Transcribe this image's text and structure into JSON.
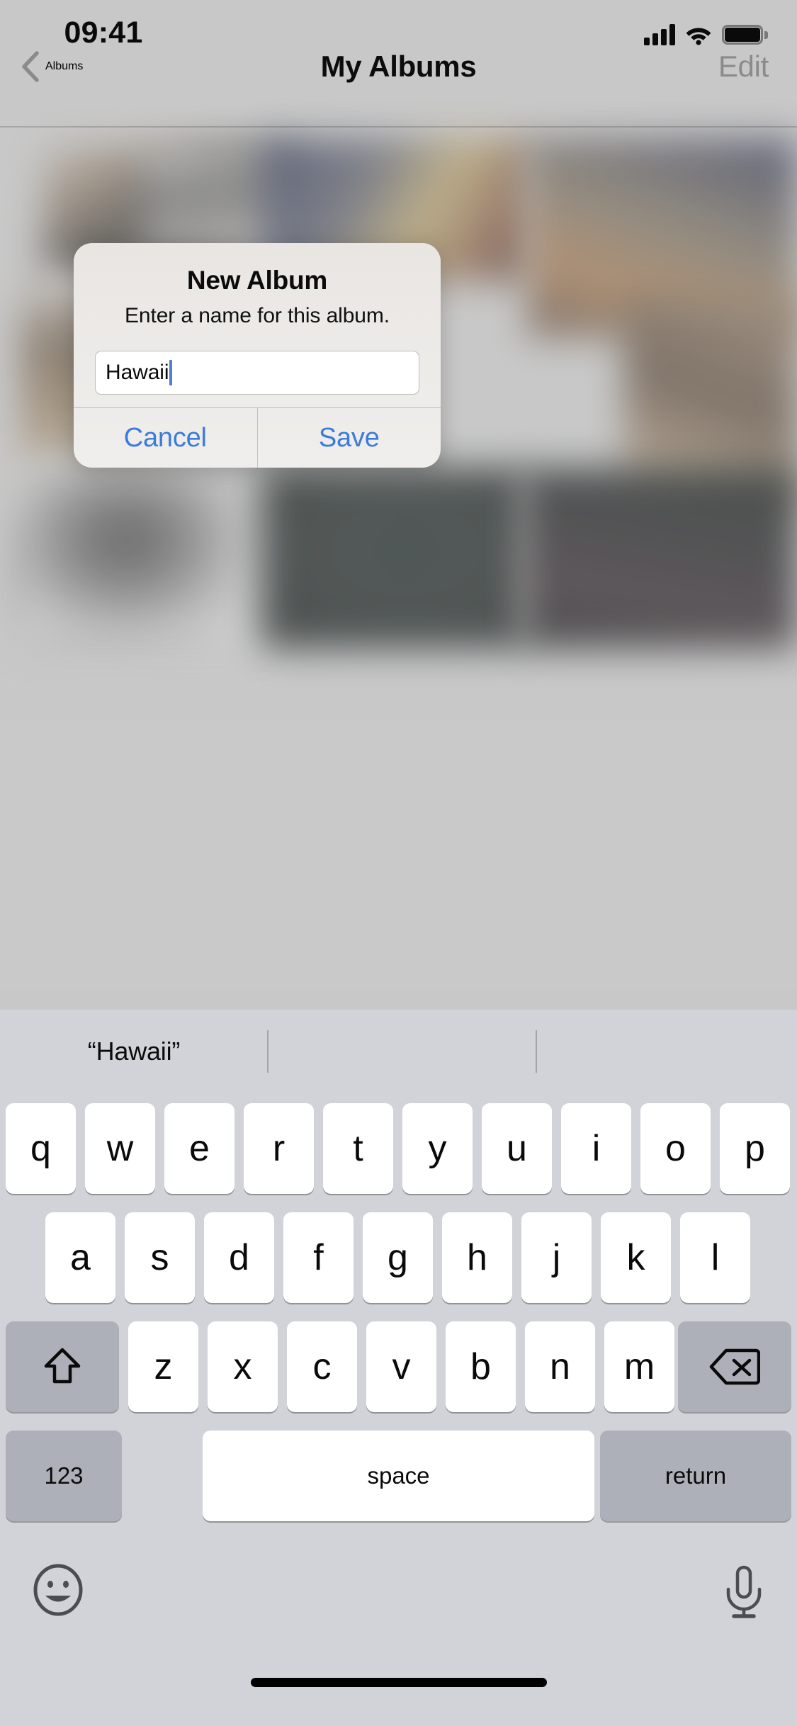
{
  "status_bar": {
    "time": "09:41",
    "cellular_icon": "cellular-bars-icon",
    "wifi_icon": "wifi-icon",
    "battery_icon": "battery-full-icon"
  },
  "nav_bar": {
    "back_label": "Albums",
    "back_icon": "chevron-left-icon",
    "title": "My Albums",
    "edit_label": "Edit"
  },
  "alert": {
    "title": "New Album",
    "message": "Enter a name for this album.",
    "textfield": {
      "value": "Hawaii",
      "placeholder": "Title"
    },
    "cancel_label": "Cancel",
    "save_label": "Save",
    "accent_color": "#3b7bdb",
    "caret_color": "#4e7fd6"
  },
  "keyboard": {
    "suggestions": [
      "“Hawaii”",
      "",
      ""
    ],
    "rows": [
      [
        "q",
        "w",
        "e",
        "r",
        "t",
        "y",
        "u",
        "i",
        "o",
        "p"
      ],
      [
        "a",
        "s",
        "d",
        "f",
        "g",
        "h",
        "j",
        "k",
        "l"
      ],
      [
        "z",
        "x",
        "c",
        "v",
        "b",
        "n",
        "m"
      ]
    ],
    "shift_icon": "shift-arrow-up-icon",
    "delete_icon": "backspace-delete-icon",
    "numbers_label": "123",
    "space_label": "space",
    "return_label": "return",
    "emoji_icon": "emoji-smiley-icon",
    "dictation_icon": "microphone-icon",
    "background_color": "#d1d3d9",
    "key_color": "#ffffff",
    "special_key_color": "#adb0b9"
  },
  "home_indicator": "home-indicator-bar"
}
